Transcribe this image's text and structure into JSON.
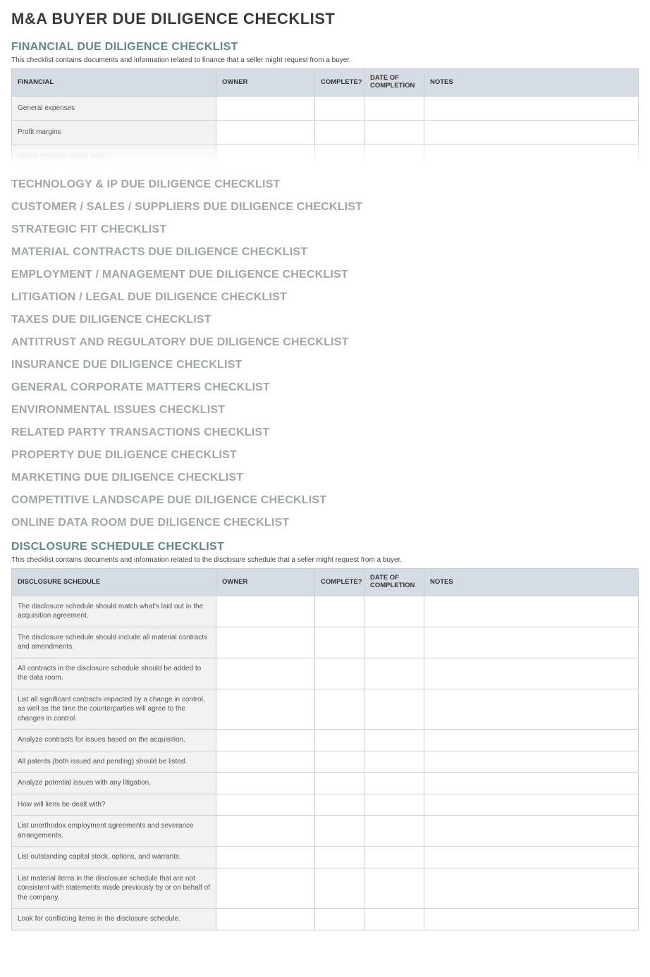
{
  "page_title": "M&A BUYER DUE DILIGENCE CHECKLIST",
  "columns": {
    "item_financial": "FINANCIAL",
    "item_disclosure": "DISCLOSURE SCHEDULE",
    "owner": "OWNER",
    "complete": "COMPLETE?",
    "date": "DATE OF COMPLETION",
    "notes": "NOTES"
  },
  "financial": {
    "title": "FINANCIAL DUE DILIGENCE CHECKLIST",
    "desc": "This checklist contains documents and information related to finance that a seller might request from a buyer.",
    "rows": [
      {
        "item": "General expenses",
        "owner": "",
        "complete": "",
        "date": "",
        "notes": ""
      },
      {
        "item": "Profit margins",
        "owner": "",
        "complete": "",
        "date": "",
        "notes": ""
      },
      {
        "item": "Where revenue comes from",
        "owner": "",
        "complete": "",
        "date": "",
        "notes": ""
      }
    ]
  },
  "collapsed_sections": [
    "TECHNOLOGY & IP DUE DILIGENCE CHECKLIST",
    "CUSTOMER / SALES / SUPPLIERS DUE DILIGENCE CHECKLIST",
    "STRATEGIC FIT CHECKLIST",
    "MATERIAL CONTRACTS DUE DILIGENCE CHECKLIST",
    "EMPLOYMENT / MANAGEMENT DUE DILIGENCE CHECKLIST",
    "LITIGATION / LEGAL DUE DILIGENCE CHECKLIST",
    "TAXES DUE DILIGENCE CHECKLIST",
    "ANTITRUST AND REGULATORY DUE DILIGENCE CHECKLIST",
    "INSURANCE DUE DILIGENCE CHECKLIST",
    "GENERAL CORPORATE MATTERS CHECKLIST",
    "ENVIRONMENTAL ISSUES CHECKLIST",
    "RELATED PARTY TRANSACTIONS CHECKLIST",
    "PROPERTY DUE DILIGENCE CHECKLIST",
    "MARKETING DUE DILIGENCE CHECKLIST",
    "COMPETITIVE LANDSCAPE DUE DILIGENCE CHECKLIST",
    "ONLINE DATA ROOM DUE DILIGENCE CHECKLIST"
  ],
  "disclosure": {
    "title": "DISCLOSURE SCHEDULE CHECKLIST",
    "desc": "This checklist contains documents and information related to the disclosure schedule that a seller might request from a buyer.",
    "rows": [
      {
        "item": "The disclosure schedule should match what's laid out in the acquisition agreement.",
        "owner": "",
        "complete": "",
        "date": "",
        "notes": ""
      },
      {
        "item": "The disclosure schedule should include all material contracts and amendments.",
        "owner": "",
        "complete": "",
        "date": "",
        "notes": ""
      },
      {
        "item": "All contracts in the disclosure schedule should be added to the data room.",
        "owner": "",
        "complete": "",
        "date": "",
        "notes": ""
      },
      {
        "item": "List all significant contracts impacted by a change in control, as well as the time the counterparties will agree to the changes in control.",
        "owner": "",
        "complete": "",
        "date": "",
        "notes": ""
      },
      {
        "item": "Analyze contracts for issues based on the acquisition.",
        "owner": "",
        "complete": "",
        "date": "",
        "notes": ""
      },
      {
        "item": "All patents (both issued and pending) should be listed.",
        "owner": "",
        "complete": "",
        "date": "",
        "notes": ""
      },
      {
        "item": "Analyze potential issues with any litigation.",
        "owner": "",
        "complete": "",
        "date": "",
        "notes": ""
      },
      {
        "item": "How will liens be dealt with?",
        "owner": "",
        "complete": "",
        "date": "",
        "notes": ""
      },
      {
        "item": "List unorthodox employment agreements and severance arrangements.",
        "owner": "",
        "complete": "",
        "date": "",
        "notes": ""
      },
      {
        "item": "List outstanding capital stock, options, and warrants.",
        "owner": "",
        "complete": "",
        "date": "",
        "notes": ""
      },
      {
        "item": "List material items in the disclosure schedule that are not consistent with statements made previously by or on behalf of the company.",
        "owner": "",
        "complete": "",
        "date": "",
        "notes": ""
      },
      {
        "item": "Look for conflicting items in the disclosure schedule.",
        "owner": "",
        "complete": "",
        "date": "",
        "notes": ""
      }
    ]
  }
}
